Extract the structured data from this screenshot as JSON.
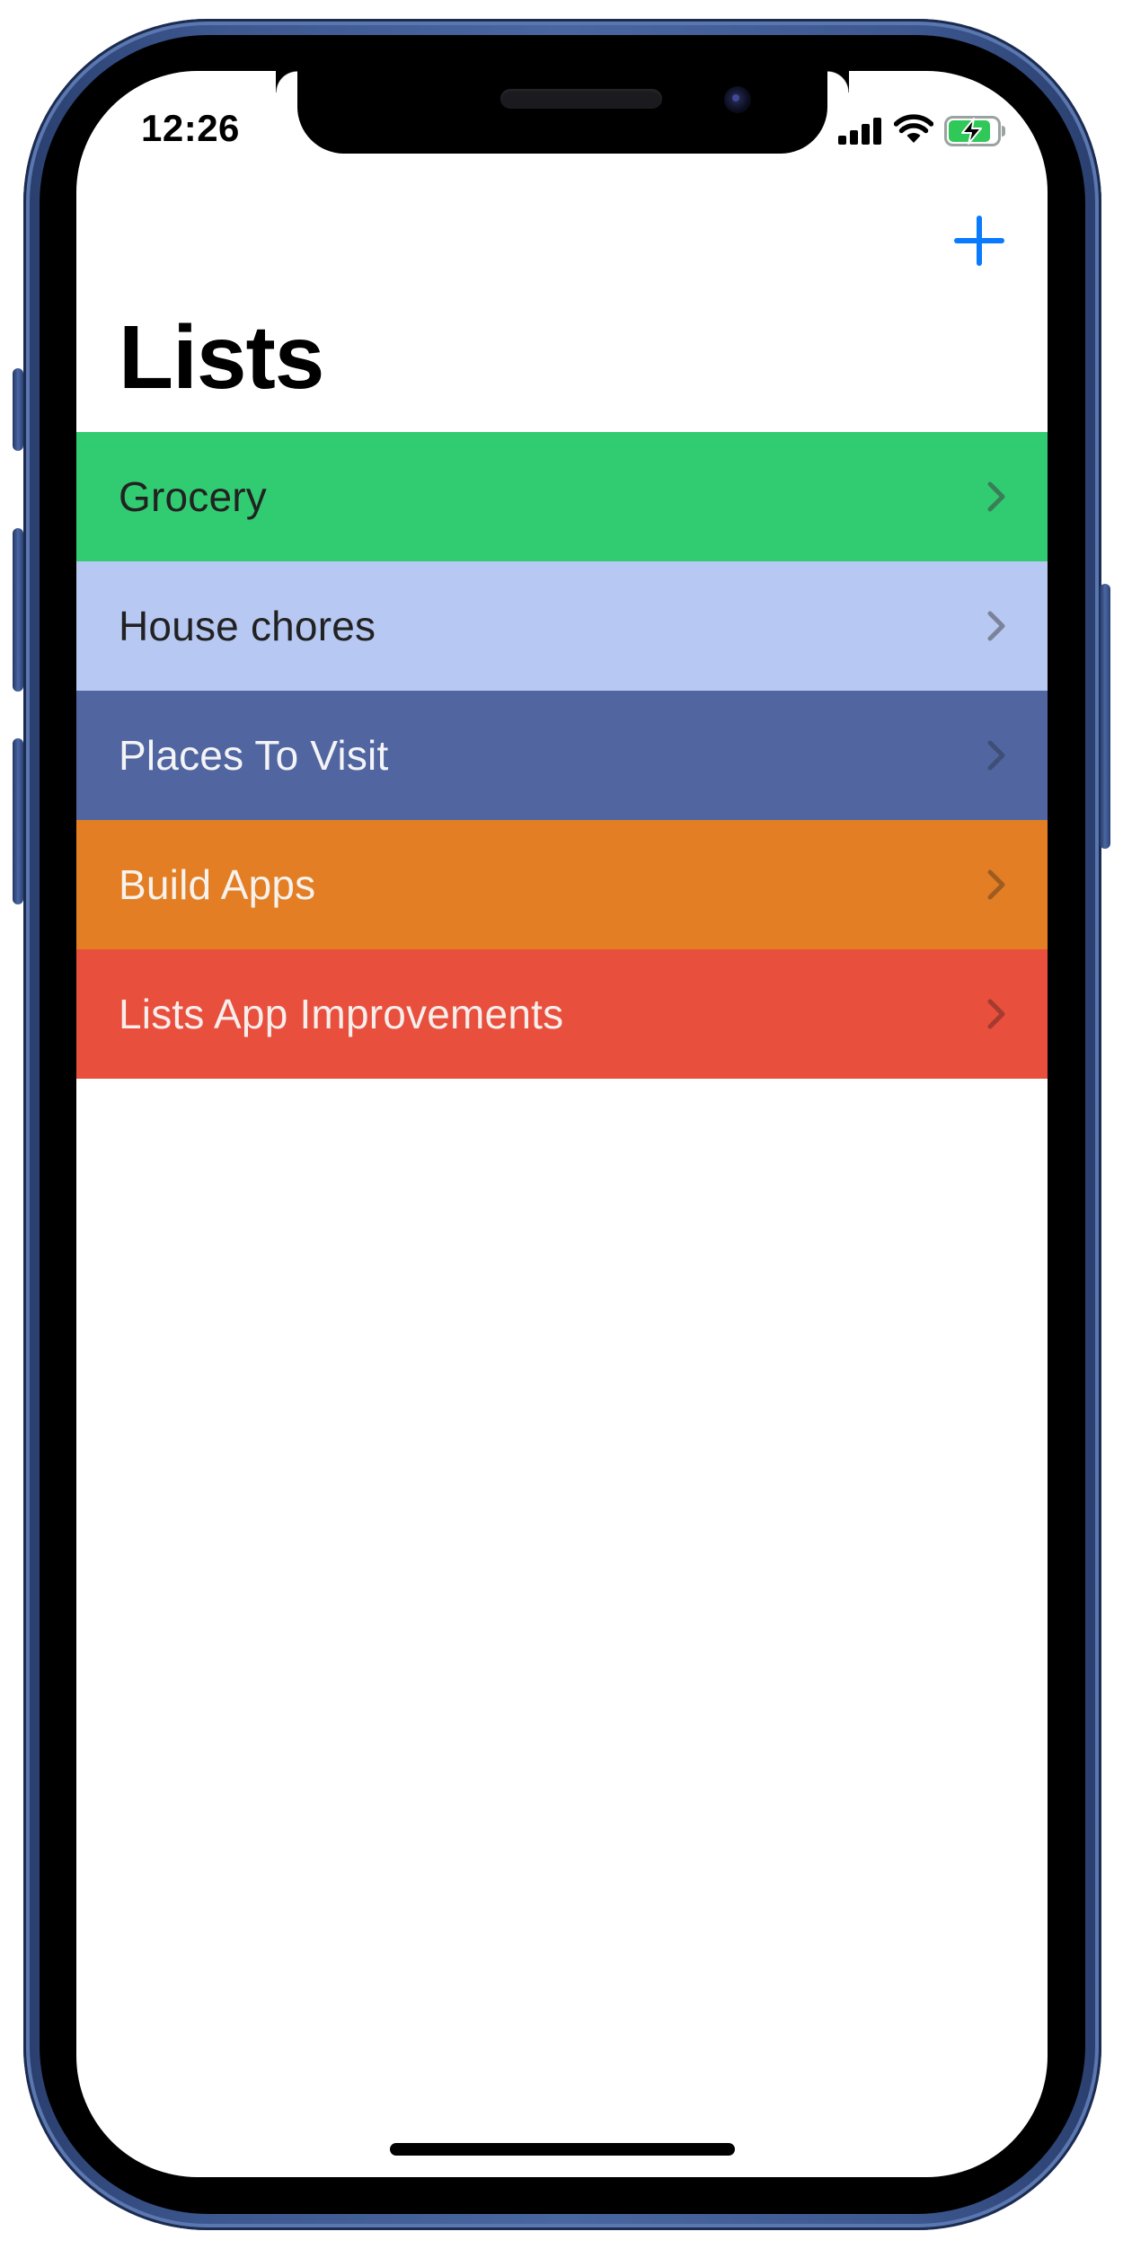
{
  "status_bar": {
    "time": "12:26"
  },
  "nav": {
    "add_icon": "plus-icon",
    "accent_color": "#0a7aff"
  },
  "title": "Lists",
  "lists": [
    {
      "label": "Grocery",
      "bg": "#31cc71",
      "text_color": "#222222",
      "chevron_color": "#3a7e57"
    },
    {
      "label": "House chores",
      "bg": "#b7c8f2",
      "text_color": "#222222",
      "chevron_color": "#7a8399"
    },
    {
      "label": "Places To Visit",
      "bg": "#5166a0",
      "text_color": "#f4f4f7",
      "chevron_color": "#3f4e77"
    },
    {
      "label": "Build Apps",
      "bg": "#e37e25",
      "text_color": "#f7f2ec",
      "chevron_color": "#9e5c22"
    },
    {
      "label": "Lists App Improvements",
      "bg": "#e84f3d",
      "text_color": "#f7eeec",
      "chevron_color": "#a53a2f"
    }
  ]
}
